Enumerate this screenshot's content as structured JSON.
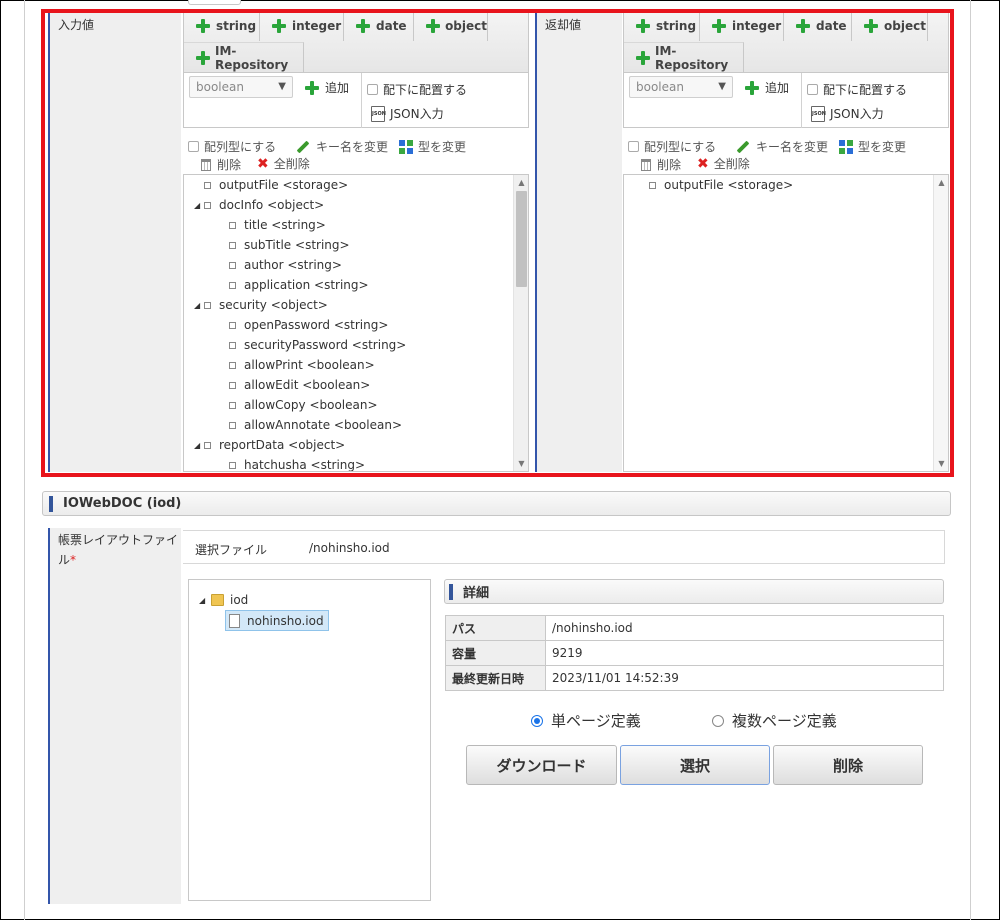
{
  "io_mapping": {
    "input": {
      "label": "入力値",
      "tabs": [
        "string",
        "integer",
        "date",
        "object",
        "IM-Repository"
      ],
      "type_select": "boolean",
      "add_label": "追加",
      "place_under_label": "配下に配置する",
      "json_input_label": "JSON入力",
      "tools": {
        "array": "配列型にする",
        "rename": "キー名を変更",
        "change_type": "型を変更",
        "delete": "削除",
        "delete_all": "全削除"
      },
      "tree": [
        {
          "name": "outputFile",
          "type": "<storage>"
        },
        {
          "name": "docInfo",
          "type": "<object>"
        },
        {
          "name": "title",
          "type": "<string>"
        },
        {
          "name": "subTitle",
          "type": "<string>"
        },
        {
          "name": "author",
          "type": "<string>"
        },
        {
          "name": "application",
          "type": "<string>"
        },
        {
          "name": "security",
          "type": "<object>"
        },
        {
          "name": "openPassword",
          "type": "<string>"
        },
        {
          "name": "securityPassword",
          "type": "<string>"
        },
        {
          "name": "allowPrint",
          "type": "<boolean>"
        },
        {
          "name": "allowEdit",
          "type": "<boolean>"
        },
        {
          "name": "allowCopy",
          "type": "<boolean>"
        },
        {
          "name": "allowAnnotate",
          "type": "<boolean>"
        },
        {
          "name": "reportData",
          "type": "<object>"
        },
        {
          "name": "hatchusha",
          "type": "<string>"
        }
      ]
    },
    "output": {
      "label": "返却値",
      "tabs": [
        "string",
        "integer",
        "date",
        "object",
        "IM-Repository"
      ],
      "type_select": "boolean",
      "add_label": "追加",
      "place_under_label": "配下に配置する",
      "json_input_label": "JSON入力",
      "tools": {
        "array": "配列型にする",
        "rename": "キー名を変更",
        "change_type": "型を変更",
        "delete": "削除",
        "delete_all": "全削除"
      },
      "tree": [
        {
          "name": "outputFile",
          "type": "<storage>"
        }
      ]
    },
    "json_icon_text": "JSON"
  },
  "iowebdoc": {
    "section_title": "IOWebDOC (iod)",
    "layout_file_label": "帳票レイアウトファイル",
    "required_mark": "*",
    "selected_file_label": "選択ファイル",
    "selected_file_value": "/nohinsho.iod",
    "file_tree": {
      "folder": "iod",
      "file": "nohinsho.iod"
    },
    "details": {
      "title": "詳細",
      "rows": [
        {
          "key": "パス",
          "value": "/nohinsho.iod"
        },
        {
          "key": "容量",
          "value": "9219"
        },
        {
          "key": "最終更新日時",
          "value": "2023/11/01 14:52:39"
        }
      ]
    },
    "page_mode": {
      "single": "単ページ定義",
      "multi": "複数ページ定義",
      "selected": "single"
    },
    "buttons": {
      "download": "ダウンロード",
      "select": "選択",
      "delete": "削除"
    }
  },
  "colors": {
    "highlight_border": "#e8141c",
    "accent": "#33559a",
    "plus_green": "#2aa53a"
  }
}
